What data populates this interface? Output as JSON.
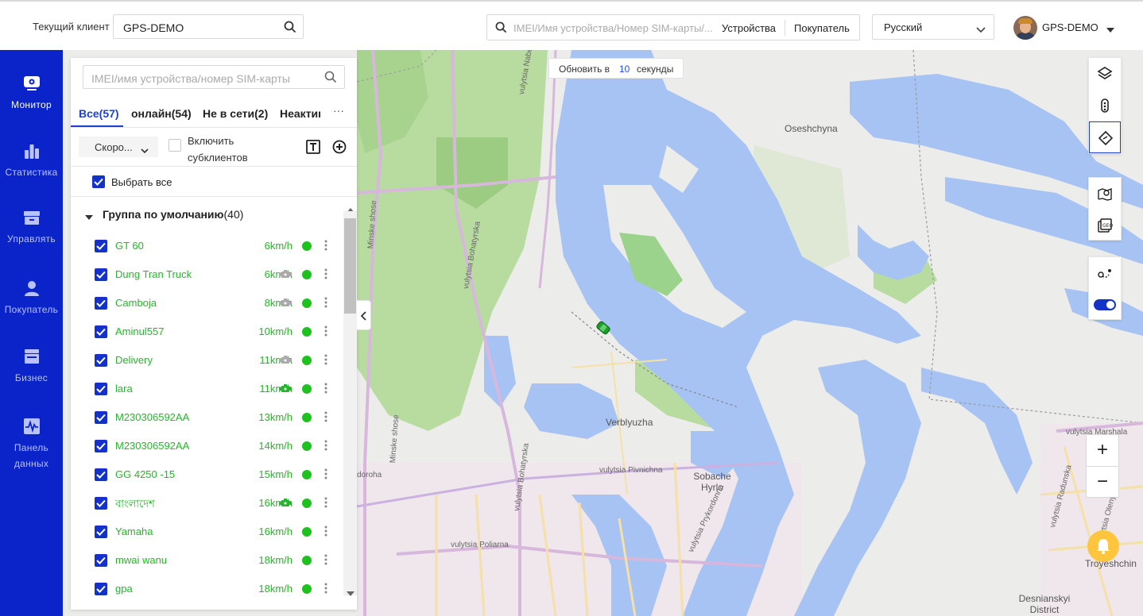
{
  "header": {
    "current_client_label": "Текущий клиент",
    "current_client_value": "GPS-DEMO",
    "global_search_placeholder": "IMEI/Имя устройства/Номер SIM-карты/...",
    "search_option_devices": "Устройства",
    "search_option_customer": "Покупатель",
    "language": "Русский",
    "user_name": "GPS-DEMO"
  },
  "sidebar": {
    "items": [
      {
        "label": "Монитор",
        "icon": "monitor-icon",
        "active": true
      },
      {
        "label": "Статистика",
        "icon": "bar-chart-icon",
        "active": false
      },
      {
        "label": "Управлять",
        "icon": "manage-box-icon",
        "active": false
      },
      {
        "label": "Покупатель",
        "icon": "person-icon",
        "active": false
      },
      {
        "label": "Бизнес",
        "icon": "store-icon",
        "active": false
      },
      {
        "label": "Панель данных",
        "icon": "dashboard-icon",
        "active": false
      }
    ]
  },
  "map": {
    "refresh_prefix": "Обновить в",
    "refresh_seconds": "10",
    "refresh_suffix": "секунды",
    "places": {
      "oseshchyna": "Oseshchyna",
      "verblyuzha": "Verblyuzha",
      "sobache_hyrlo": "Sobache\nHyrlo",
      "troyeshchina": "Troyeshchin",
      "desnianskyi": "Desnianskyi\nDistrict"
    },
    "streets": {
      "naberezhna": "vulytsia Naberezhna",
      "minske_1": "Minske shose",
      "minske_2": "Minske shose",
      "bohatyrska_1": "vulytsia Bohatyrska",
      "bohatyrska_2": "vulytsia Bohatyrska",
      "pivnichna": "vulytsia Pivnichna",
      "poliarna": "vulytsia Poliarna",
      "dorozha": "doroha",
      "radunska": "vulytsia Radunska",
      "prykordonna": "vulytsia Prykordonna",
      "marshala": "vulytsia Marshala",
      "oleny": "vulytsia Oleny"
    },
    "tools": [
      "layers-icon",
      "traffic-light-icon",
      "direction-icon",
      "map-search-icon",
      "satellite-view-icon",
      "route-icon",
      "toggle-switch-icon"
    ],
    "toggle_on": true,
    "zoom_in": "+",
    "zoom_out": "−"
  },
  "panel": {
    "search_placeholder": "IMEI/имя устройства/номер SIM-карты",
    "tabs": [
      {
        "label": "Все(57)",
        "active": true
      },
      {
        "label": "онлайн(54)",
        "active": false
      },
      {
        "label": "Не в сети(2)",
        "active": false
      },
      {
        "label": "Неактивен",
        "active": false
      }
    ],
    "tab_more": "···",
    "sort_value": "Скоро...",
    "include_subclients": "Включить субклиентов",
    "select_all": "Выбрать все",
    "group_name": "Группа по умолчанию",
    "group_count": "(40)",
    "devices": [
      {
        "name": "GT 60",
        "speed": "6km/h",
        "engine": "none"
      },
      {
        "name": "Dung Tran Truck",
        "speed": "6km/h",
        "engine": "gray"
      },
      {
        "name": "Camboja",
        "speed": "8km/h",
        "engine": "gray"
      },
      {
        "name": "Aminul557",
        "speed": "10km/h",
        "engine": "none"
      },
      {
        "name": "Delivery",
        "speed": "11km/h",
        "engine": "gray"
      },
      {
        "name": "lara",
        "speed": "11km/h",
        "engine": "green"
      },
      {
        "name": "M230306592AA",
        "speed": "13km/h",
        "engine": "none"
      },
      {
        "name": "M230306592AA",
        "speed": "14km/h",
        "engine": "none"
      },
      {
        "name": "GG 4250 -15",
        "speed": "15km/h",
        "engine": "none"
      },
      {
        "name": "বাংলাদেশ",
        "speed": "16km/h",
        "engine": "green"
      },
      {
        "name": "Yamaha",
        "speed": "16km/h",
        "engine": "none"
      },
      {
        "name": "mwai wanu",
        "speed": "18km/h",
        "engine": "none"
      },
      {
        "name": "gpa",
        "speed": "18km/h",
        "engine": "none"
      }
    ]
  },
  "colors": {
    "sidebar_bg": "#0b24c9",
    "online_green": "#27b52d",
    "accent_blue": "#1e3fd0",
    "water": "#a6c3f3",
    "park": "#a8d38e",
    "bell": "#ffc53d"
  }
}
